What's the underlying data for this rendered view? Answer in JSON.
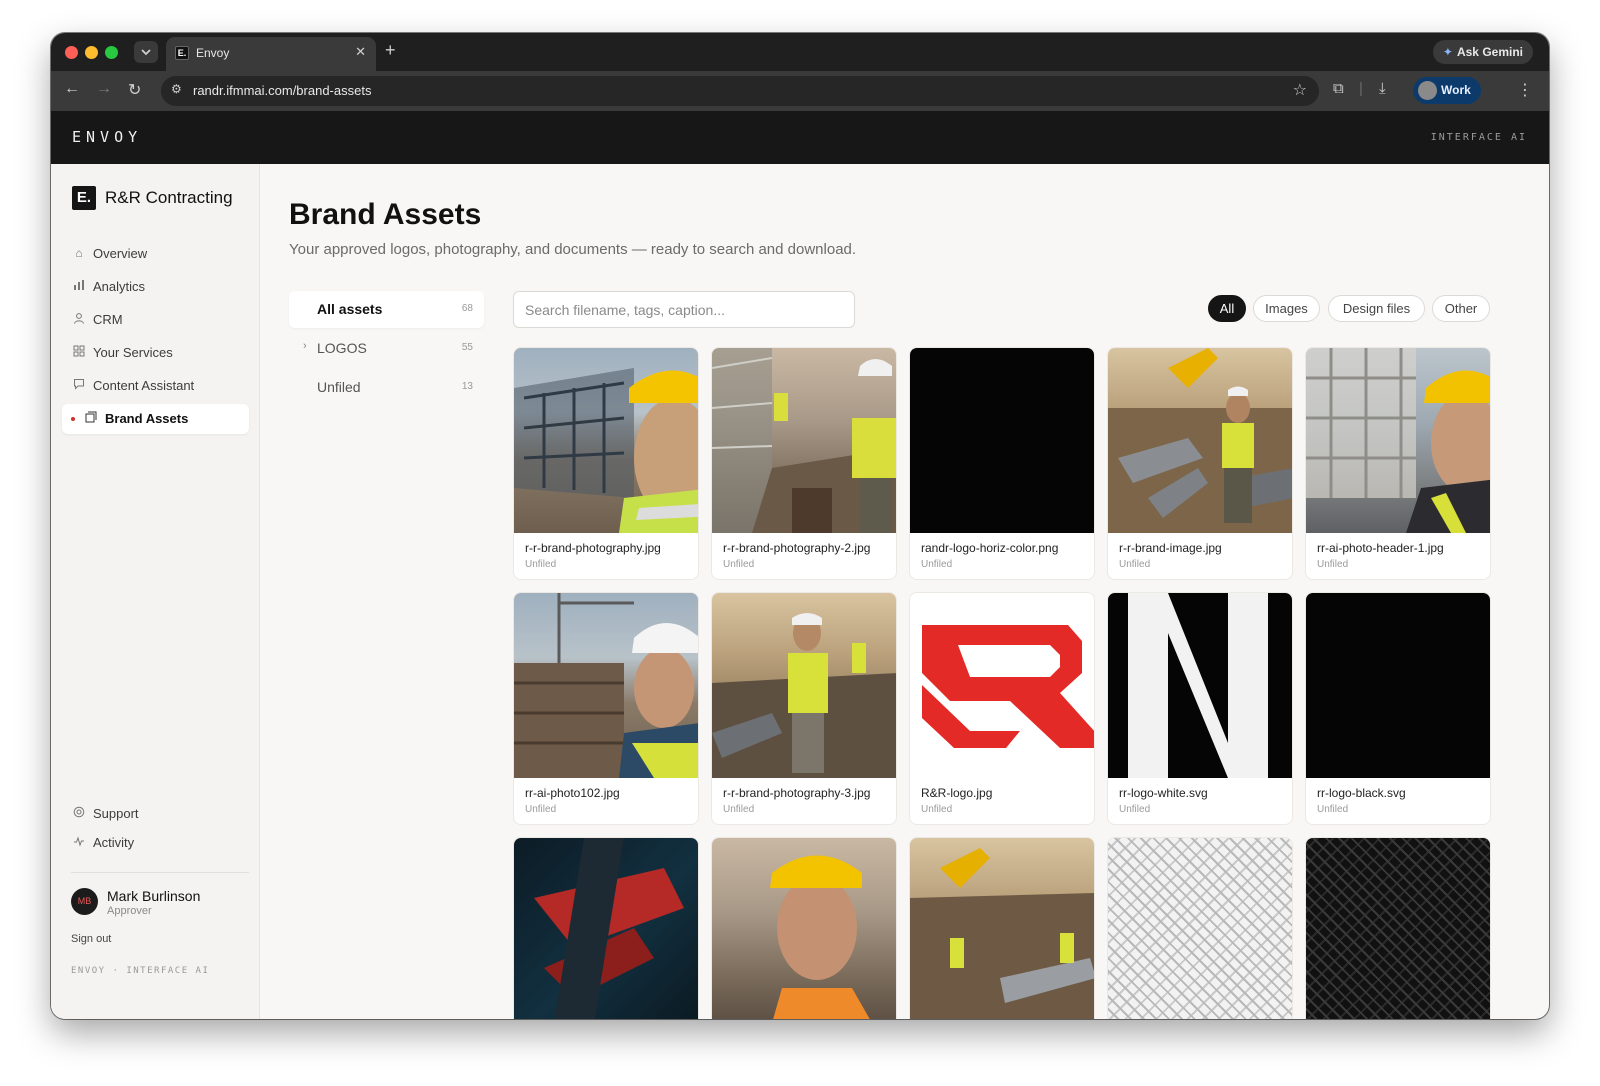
{
  "browser": {
    "tab_title": "Envoy",
    "tab_favicon": "E.",
    "new_tab_icon": "plus-icon",
    "ask_gemini": "Ask Gemini",
    "url": "randr.ifmmai.com/brand-assets",
    "profile": "Work"
  },
  "app_header": {
    "wordmark": "ENVOY",
    "tagline": "INTERFACE AI"
  },
  "sidebar": {
    "org_logo": "E.",
    "org_name": "R&R Contracting",
    "nav": [
      {
        "label": "Overview",
        "icon": "home-icon"
      },
      {
        "label": "Analytics",
        "icon": "bar-chart-icon"
      },
      {
        "label": "CRM",
        "icon": "user-icon"
      },
      {
        "label": "Your Services",
        "icon": "grid-icon"
      },
      {
        "label": "Content Assistant",
        "icon": "chat-icon"
      },
      {
        "label": "Brand Assets",
        "icon": "images-icon",
        "active": true
      }
    ],
    "secondary": [
      {
        "label": "Support",
        "icon": "lifebuoy-icon"
      },
      {
        "label": "Activity",
        "icon": "activity-icon"
      }
    ],
    "user": {
      "initials": "MB",
      "name": "Mark Burlinson",
      "role": "Approver"
    },
    "sign_out": "Sign out",
    "footer": "ENVOY · INTERFACE AI"
  },
  "main": {
    "title": "Brand Assets",
    "subtitle": "Your approved logos, photography, and documents — ready to search and download.",
    "folders": [
      {
        "label": "All assets",
        "count": "68",
        "active": true
      },
      {
        "label": "LOGOS",
        "count": "55",
        "expandable": true
      },
      {
        "label": "Unfiled",
        "count": "13"
      }
    ],
    "search_placeholder": "Search filename, tags, caption...",
    "filters": [
      {
        "label": "All",
        "active": true
      },
      {
        "label": "Images"
      },
      {
        "label": "Design files"
      },
      {
        "label": "Other"
      }
    ],
    "assets": [
      {
        "name": "r-r-brand-photography.jpg",
        "folder": "Unfiled"
      },
      {
        "name": "r-r-brand-photography-2.jpg",
        "folder": "Unfiled"
      },
      {
        "name": "randr-logo-horiz-color.png",
        "folder": "Unfiled"
      },
      {
        "name": "r-r-brand-image.jpg",
        "folder": "Unfiled"
      },
      {
        "name": "rr-ai-photo-header-1.jpg",
        "folder": "Unfiled"
      },
      {
        "name": "rr-ai-photo102.jpg",
        "folder": "Unfiled"
      },
      {
        "name": "r-r-brand-photography-3.jpg",
        "folder": "Unfiled"
      },
      {
        "name": "R&R-logo.jpg",
        "folder": "Unfiled"
      },
      {
        "name": "rr-logo-white.svg",
        "folder": "Unfiled"
      },
      {
        "name": "rr-logo-black.svg",
        "folder": "Unfiled"
      },
      {
        "name": "",
        "folder": ""
      },
      {
        "name": "",
        "folder": ""
      },
      {
        "name": "",
        "folder": ""
      },
      {
        "name": "",
        "folder": ""
      },
      {
        "name": "",
        "folder": ""
      }
    ]
  },
  "colors": {
    "brand_red": "#d32f2f",
    "header_bg": "#171717",
    "sidebar_bg": "#f4f3f1",
    "page_bg": "#f8f7f5"
  }
}
